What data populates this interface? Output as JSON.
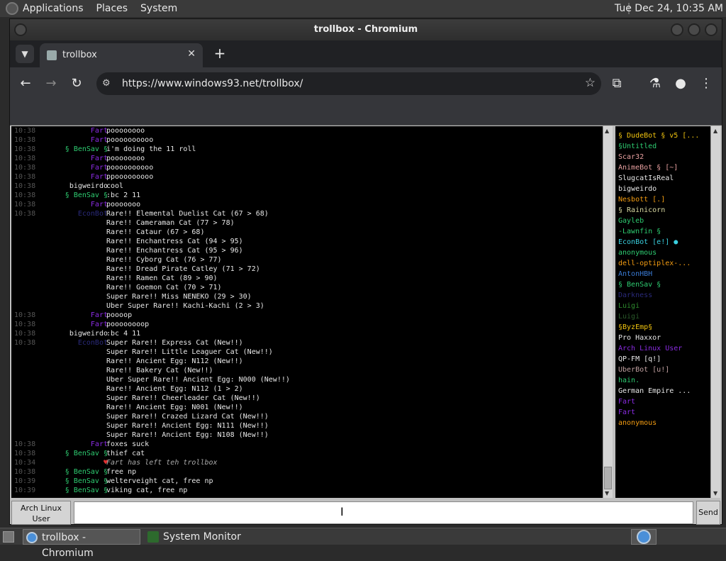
{
  "top_panel": {
    "menus": [
      "Applications",
      "Places",
      "System"
    ],
    "clock": "Tue Dec 24, 10:35 AM"
  },
  "window": {
    "title": "trollbox - Chromium"
  },
  "browser": {
    "tab_title": "trollbox",
    "url": "https://www.windows93.net/trollbox/"
  },
  "chat": {
    "messages": [
      {
        "time": "10:38",
        "nick": "Fart",
        "nick_color": "#8a2be2",
        "text": "poooooooo"
      },
      {
        "time": "10:38",
        "nick": "Fart",
        "nick_color": "#8a2be2",
        "text": "poooooooooo"
      },
      {
        "time": "10:38",
        "nick": "§ BenSav §",
        "nick_color": "#2ecc71",
        "text": "i'm doing the 11 roll"
      },
      {
        "time": "10:38",
        "nick": "Fart",
        "nick_color": "#8a2be2",
        "text": "poooooooo"
      },
      {
        "time": "10:38",
        "nick": "Fart",
        "nick_color": "#8a2be2",
        "text": "poooooooooo"
      },
      {
        "time": "10:38",
        "nick": "Fart",
        "nick_color": "#8a2be2",
        "text": "ppooooooooo"
      },
      {
        "time": "10:38",
        "nick": "bigweirdo",
        "nick_color": "#e8e8e8",
        "text": "cool"
      },
      {
        "time": "10:38",
        "nick": "§ BenSav §",
        "nick_color": "#2ecc71",
        "text": ":bc 2 11"
      },
      {
        "time": "10:38",
        "nick": "Fart",
        "nick_color": "#8a2be2",
        "text": "pooooooo"
      },
      {
        "time": "10:38",
        "nick": "EconBot",
        "nick_color": "#2a2a7a",
        "text": "Rare!! Elemental Duelist Cat (67 > 68)"
      },
      {
        "time": "",
        "nick": "",
        "nick_color": "#e8e8e8",
        "text": "Rare!! Cameraman Cat (77 > 78)"
      },
      {
        "time": "",
        "nick": "",
        "nick_color": "#e8e8e8",
        "text": "Rare!! Cataur (67 > 68)"
      },
      {
        "time": "",
        "nick": "",
        "nick_color": "#e8e8e8",
        "text": "Rare!! Enchantress Cat (94 > 95)"
      },
      {
        "time": "",
        "nick": "",
        "nick_color": "#e8e8e8",
        "text": "Rare!! Enchantress Cat (95 > 96)"
      },
      {
        "time": "",
        "nick": "",
        "nick_color": "#e8e8e8",
        "text": "Rare!! Cyborg Cat (76 > 77)"
      },
      {
        "time": "",
        "nick": "",
        "nick_color": "#e8e8e8",
        "text": "Rare!! Dread Pirate Catley (71 > 72)"
      },
      {
        "time": "",
        "nick": "",
        "nick_color": "#e8e8e8",
        "text": "Rare!! Ramen Cat (89 > 90)"
      },
      {
        "time": "",
        "nick": "",
        "nick_color": "#e8e8e8",
        "text": "Rare!! Goemon Cat (70 > 71)"
      },
      {
        "time": "",
        "nick": "",
        "nick_color": "#e8e8e8",
        "text": "Super Rare!! Miss NENEKO (29 > 30)"
      },
      {
        "time": "",
        "nick": "",
        "nick_color": "#e8e8e8",
        "text": "Uber Super Rare!! Kachi-Kachi (2 > 3)"
      },
      {
        "time": "10:38",
        "nick": "Fart",
        "nick_color": "#8a2be2",
        "text": "poooop"
      },
      {
        "time": "10:38",
        "nick": "Fart",
        "nick_color": "#8a2be2",
        "text": "poooooooop"
      },
      {
        "time": "10:38",
        "nick": "bigweirdo",
        "nick_color": "#e8e8e8",
        "text": ":bc 4 11"
      },
      {
        "time": "10:38",
        "nick": "EconBot",
        "nick_color": "#2a2a7a",
        "text": "Super Rare!! Express Cat (New!!)"
      },
      {
        "time": "",
        "nick": "",
        "nick_color": "#e8e8e8",
        "text": "Super Rare!! Little Leaguer Cat (New!!)"
      },
      {
        "time": "",
        "nick": "",
        "nick_color": "#e8e8e8",
        "text": "Rare!! Ancient Egg: N112 (New!!)"
      },
      {
        "time": "",
        "nick": "",
        "nick_color": "#e8e8e8",
        "text": "Rare!! Bakery Cat (New!!)"
      },
      {
        "time": "",
        "nick": "",
        "nick_color": "#e8e8e8",
        "text": "Uber Super Rare!! Ancient Egg: N000 (New!!)"
      },
      {
        "time": "",
        "nick": "",
        "nick_color": "#e8e8e8",
        "text": "Rare!! Ancient Egg: N112 (1 > 2)"
      },
      {
        "time": "",
        "nick": "",
        "nick_color": "#e8e8e8",
        "text": "Super Rare!! Cheerleader Cat (New!!)"
      },
      {
        "time": "",
        "nick": "",
        "nick_color": "#e8e8e8",
        "text": "Rare!! Ancient Egg: N001 (New!!)"
      },
      {
        "time": "",
        "nick": "",
        "nick_color": "#e8e8e8",
        "text": "Super Rare!! Crazed Lizard Cat (New!!)"
      },
      {
        "time": "",
        "nick": "",
        "nick_color": "#e8e8e8",
        "text": "Super Rare!! Ancient Egg: N111 (New!!)"
      },
      {
        "time": "",
        "nick": "",
        "nick_color": "#e8e8e8",
        "text": "Super Rare!! Ancient Egg: N108 (New!!)"
      },
      {
        "time": "10:38",
        "nick": "Fart",
        "nick_color": "#8a2be2",
        "text": "foxes suck"
      },
      {
        "time": "10:38",
        "nick": "§ BenSav §",
        "nick_color": "#2ecc71",
        "text": "thief cat"
      },
      {
        "time": "10:34",
        "nick": "♥",
        "nick_color": "#e03030",
        "text": "Fart has left teh trollbox",
        "system": true
      },
      {
        "time": "10:38",
        "nick": "§ BenSav §",
        "nick_color": "#2ecc71",
        "text": "free np"
      },
      {
        "time": "10:39",
        "nick": "§ BenSav §",
        "nick_color": "#2ecc71",
        "text": "welterveight cat, free np"
      },
      {
        "time": "10:39",
        "nick": "§ BenSav §",
        "nick_color": "#2ecc71",
        "text": "viking cat, free np"
      }
    ]
  },
  "users": [
    {
      "name": "§ DudeBot § v5 [...",
      "color": "#f1c40f"
    },
    {
      "name": "§Untitled",
      "color": "#2ecc71"
    },
    {
      "name": "Scar32",
      "color": "#e8a0a0"
    },
    {
      "name": "AnimeBot § [~]",
      "color": "#e8a0a0"
    },
    {
      "name": "SlugcatIsReal",
      "color": "#e8e8e8"
    },
    {
      "name": "bigweirdo",
      "color": "#e8e8e8"
    },
    {
      "name": "Nesbott [.]",
      "color": "#f39c12"
    },
    {
      "name": "§ Rainicorn",
      "color": "#d8d8a0"
    },
    {
      "name": "Gayleb",
      "color": "#2ecc71"
    },
    {
      "name": "-Lawnfin §",
      "color": "#2ecc71"
    },
    {
      "name": "EconBot [e!] ●",
      "color": "#3ad0e0"
    },
    {
      "name": "anonymous",
      "color": "#2ecc71"
    },
    {
      "name": "dell-optiplex-...",
      "color": "#f39c12"
    },
    {
      "name": "AntonHBH",
      "color": "#3a7bd5"
    },
    {
      "name": "§ BenSav §",
      "color": "#2ecc71"
    },
    {
      "name": "Darkness",
      "color": "#2a2a7a"
    },
    {
      "name": "Luigi",
      "color": "#2e8b2e"
    },
    {
      "name": "Luigi",
      "color": "#2a5a2a"
    },
    {
      "name": "§ByzEmp§",
      "color": "#f1c40f"
    },
    {
      "name": "Pro Haxxor",
      "color": "#e8e8e8"
    },
    {
      "name": "Arch Linux User",
      "color": "#8a2be2"
    },
    {
      "name": "QP-FM [q!]",
      "color": "#e8e8e8"
    },
    {
      "name": "UberBot [u!]",
      "color": "#c0a0a0"
    },
    {
      "name": "hain.",
      "color": "#2ecc71"
    },
    {
      "name": "German Empire ...",
      "color": "#e8e8e8"
    },
    {
      "name": "Fart",
      "color": "#8a2be2"
    },
    {
      "name": "Fart",
      "color": "#8a2be2"
    },
    {
      "name": "anonymous",
      "color": "#f39c12"
    }
  ],
  "input": {
    "nickname": "Arch Linux User",
    "message_value": "",
    "send_label": "Send"
  },
  "taskbar": {
    "tasks": [
      "trollbox - Chromium",
      "System Monitor"
    ]
  }
}
